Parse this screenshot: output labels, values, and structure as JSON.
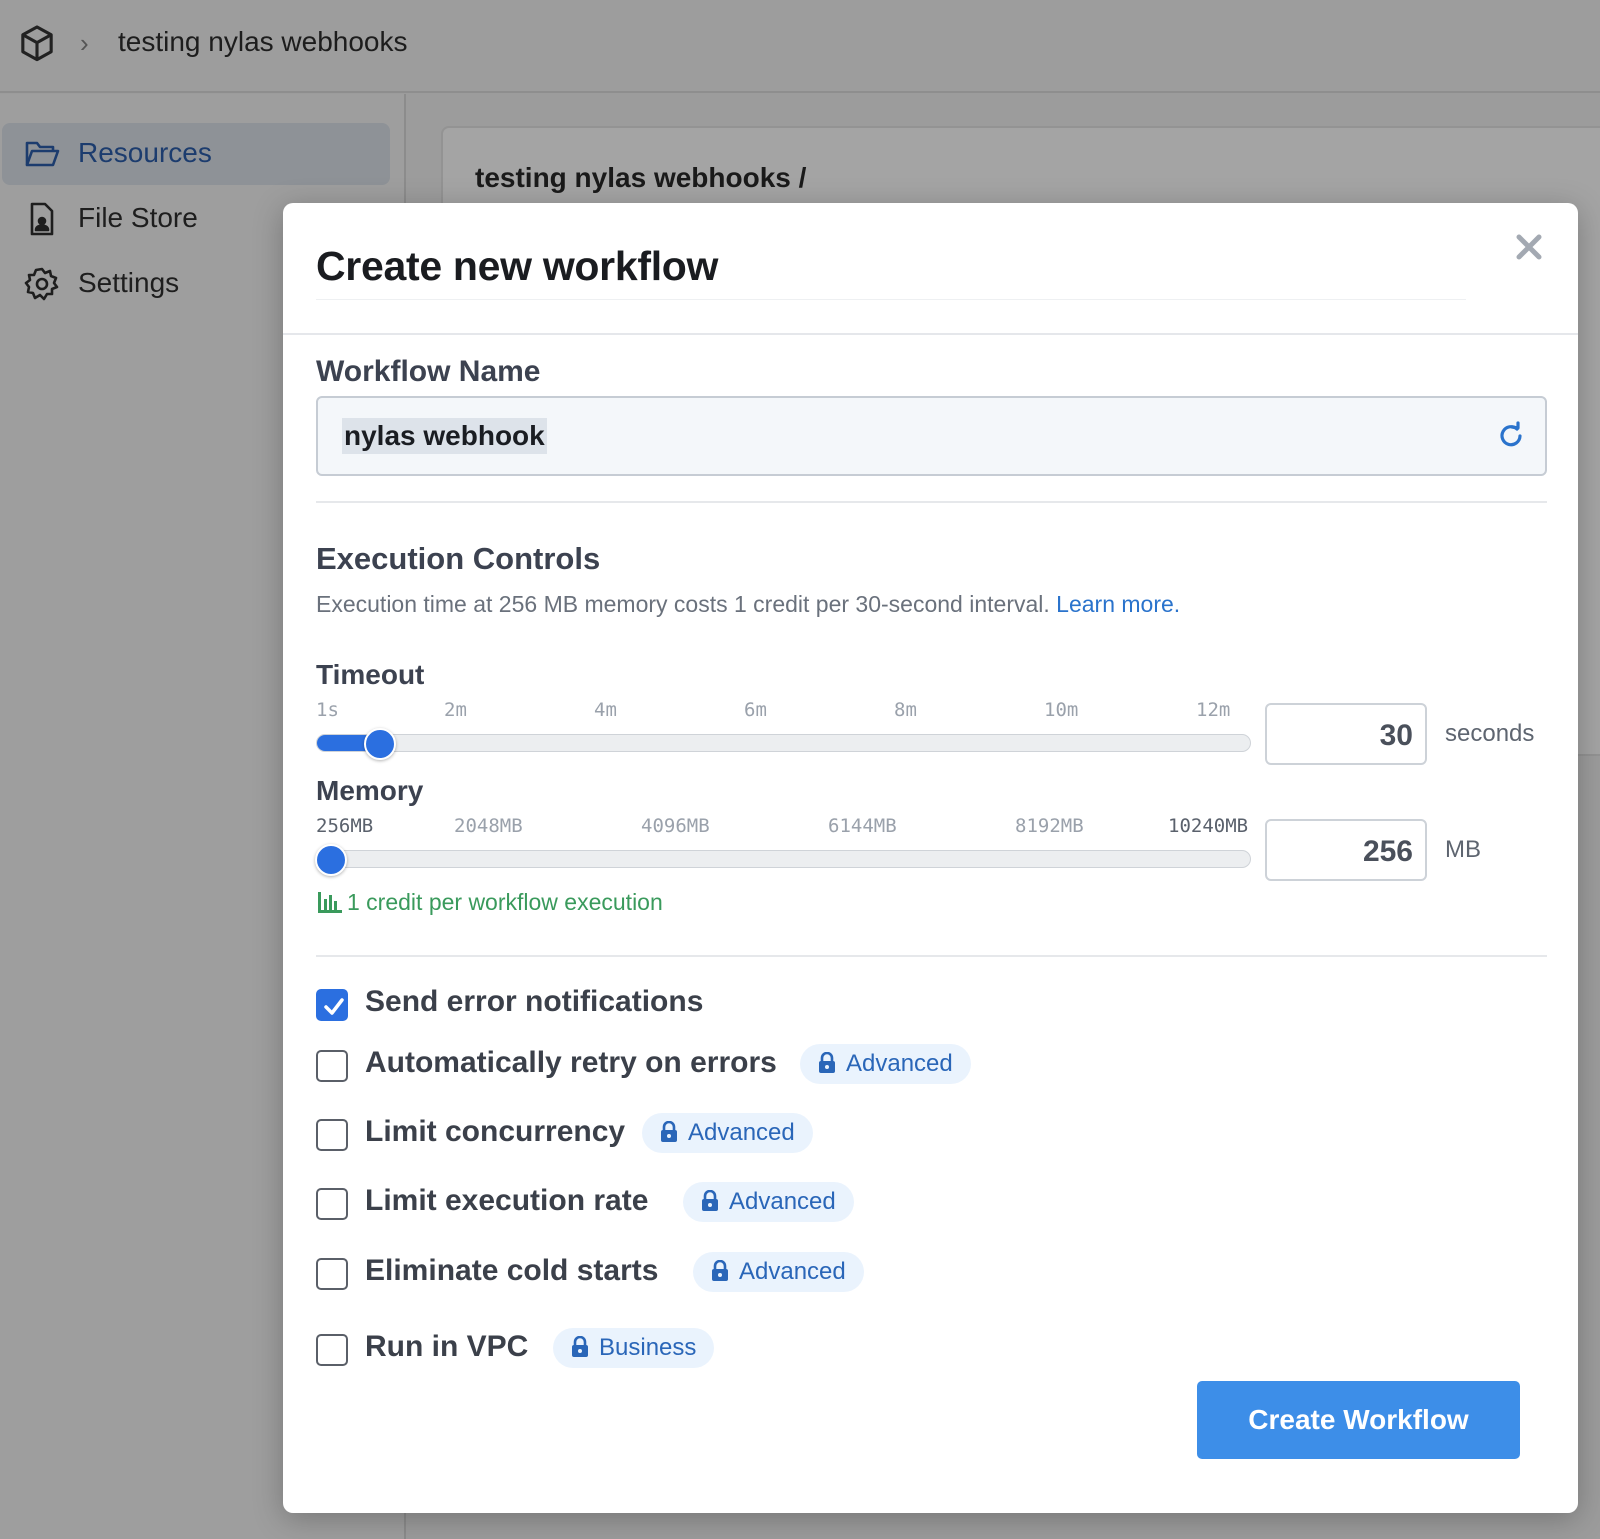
{
  "topbar": {
    "breadcrumb": "testing nylas webhooks"
  },
  "sidebar": {
    "items": [
      {
        "label": "Resources",
        "icon": "folder-open-icon"
      },
      {
        "label": "File Store",
        "icon": "file-icon"
      },
      {
        "label": "Settings",
        "icon": "gear-icon"
      }
    ]
  },
  "background": {
    "card_title": "testing nylas webhooks  /"
  },
  "modal": {
    "title": "Create new workflow",
    "workflow_name": {
      "label": "Workflow Name",
      "value": "nylas webhook"
    },
    "execution": {
      "title": "Execution Controls",
      "description": "Execution time at 256 MB memory costs 1 credit per 30-second interval.",
      "learn_more": "Learn more."
    },
    "timeout": {
      "label": "Timeout",
      "ticks": [
        "1s",
        "2m",
        "4m",
        "6m",
        "8m",
        "10m",
        "12m"
      ],
      "value": "30",
      "unit": "seconds",
      "level": 0.054
    },
    "memory": {
      "label": "Memory",
      "ticks": [
        "256MB",
        "2048MB",
        "4096MB",
        "6144MB",
        "8192MB",
        "10240MB"
      ],
      "value": "256",
      "unit": "MB",
      "level": 0.0
    },
    "credit_note": "1 credit per workflow execution",
    "options": [
      {
        "label": "Send error notifications",
        "checked": true,
        "badge": ""
      },
      {
        "label": "Automatically retry on errors",
        "checked": false,
        "badge": "Advanced"
      },
      {
        "label": "Limit concurrency",
        "checked": false,
        "badge": "Advanced"
      },
      {
        "label": "Limit execution rate",
        "checked": false,
        "badge": "Advanced"
      },
      {
        "label": "Eliminate cold starts",
        "checked": false,
        "badge": "Advanced"
      },
      {
        "label": "Run in VPC",
        "checked": false,
        "badge": "Business"
      }
    ],
    "submit_label": "Create Workflow"
  },
  "colors": {
    "accent": "#2b6fe0",
    "button": "#3d8ee8",
    "success": "#3a9a5c",
    "link": "#2a73cc"
  }
}
